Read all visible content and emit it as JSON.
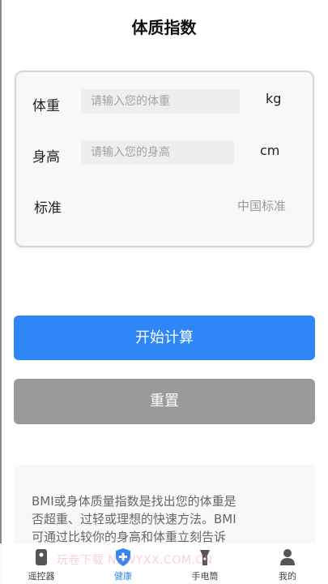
{
  "page": {
    "title": "体质指数"
  },
  "form": {
    "weight": {
      "label": "体重",
      "placeholder": "请输入您的体重",
      "unit": "kg"
    },
    "height": {
      "label": "身高",
      "placeholder": "请输入您的身高",
      "unit": "cm"
    },
    "standard": {
      "label": "标准",
      "value": "中国标准"
    }
  },
  "buttons": {
    "start": "开始计算",
    "reset": "重置"
  },
  "info": {
    "lines": [
      "BMI或身体质量指数是找出您的体重是",
      "否超重、过轻或理想的快速方法。BMI",
      "可通过比较你的身高和体重立刻告诉"
    ]
  },
  "tabs": [
    {
      "label": "遥控器",
      "icon": "remote-icon"
    },
    {
      "label": "健康",
      "icon": "health-shield-icon"
    },
    {
      "label": "手电筒",
      "icon": "flashlight-icon"
    },
    {
      "label": "我的",
      "icon": "user-icon"
    }
  ],
  "watermark": "玩卷下载 NBWYXX.COM.CN",
  "colors": {
    "accent": "#2f86f6",
    "reset": "#9a9a9a",
    "card_bg": "#f7f8fa"
  }
}
